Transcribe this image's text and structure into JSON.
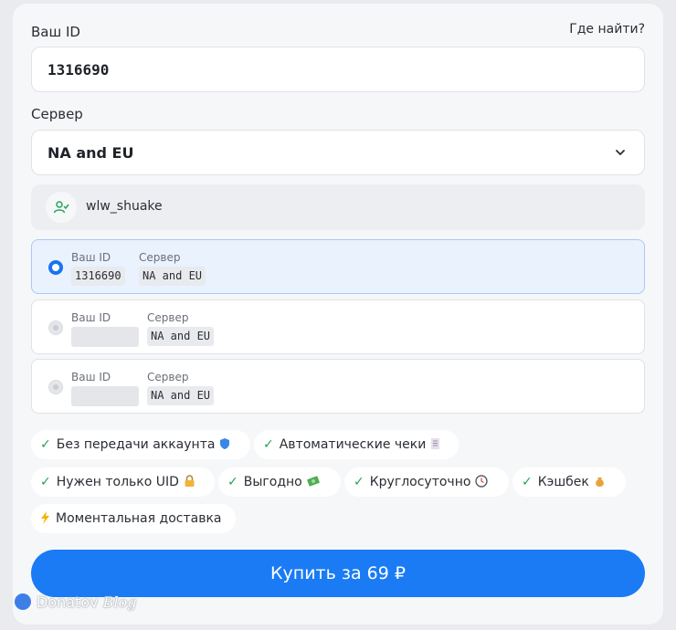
{
  "form": {
    "id_label": "Ваш ID",
    "where_link": "Где найти?",
    "id_value": "1316690",
    "server_label": "Сервер",
    "server_value": "NA and EU",
    "username": "wlw_shuake"
  },
  "saved": [
    {
      "id_label": "Ваш ID",
      "server_label": "Сервер",
      "id_value": "1316690",
      "server_value": "NA and EU",
      "selected": true
    },
    {
      "id_label": "Ваш ID",
      "server_label": "Сервер",
      "id_value": "",
      "server_value": "NA and EU",
      "selected": false
    },
    {
      "id_label": "Ваш ID",
      "server_label": "Сервер",
      "id_value": "",
      "server_value": "NA and EU",
      "selected": false
    }
  ],
  "features": [
    {
      "text": "Без передачи аккаунта",
      "icon": "shield-icon"
    },
    {
      "text": "Автоматические чеки",
      "icon": "receipt-icon"
    },
    {
      "text": "Нужен только UID",
      "icon": "lock-icon"
    },
    {
      "text": "Выгодно",
      "icon": "money-icon"
    },
    {
      "text": "Круглосуточно",
      "icon": "clock-icon"
    },
    {
      "text": "Кэшбек",
      "icon": "money-bag-icon"
    },
    {
      "text": "Моментальная доставка",
      "icon": "lightning-icon"
    }
  ],
  "buy_button": "Купить за 69 ₽",
  "watermark": {
    "brand": "Donatov",
    "suffix": "Blog"
  },
  "colors": {
    "accent": "#1a7bf5",
    "check": "#22a35a"
  }
}
